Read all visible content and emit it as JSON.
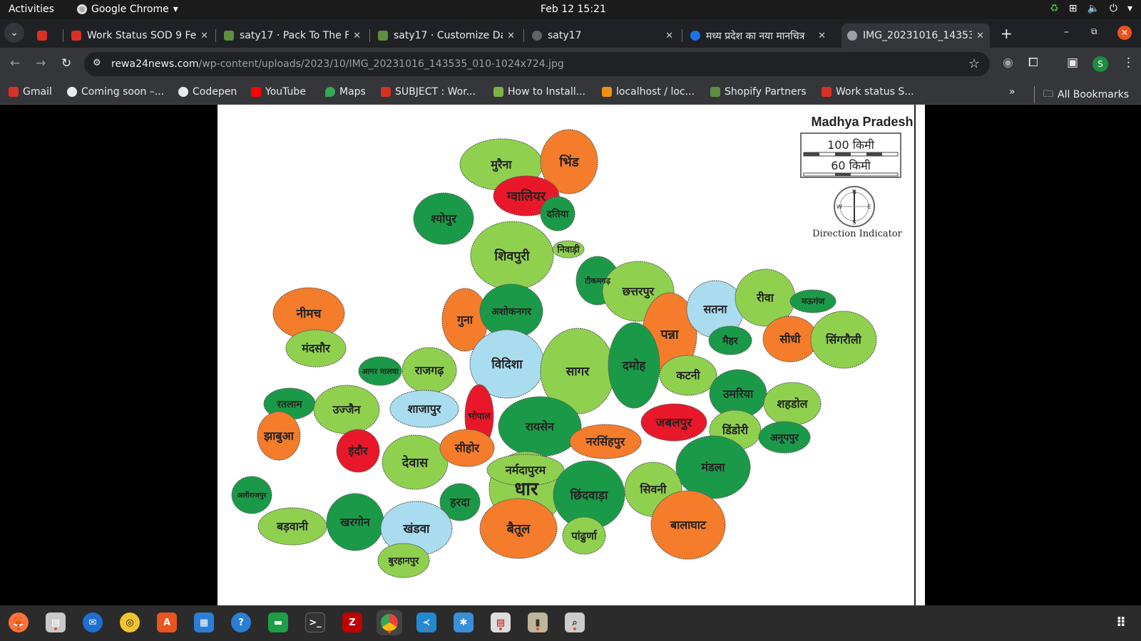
{
  "system_bar": {
    "activities": "Activities",
    "app_name": "Google Chrome",
    "clock": "Feb 12  15:21"
  },
  "tabs": [
    {
      "title": "",
      "favicon_color": "#d93025"
    },
    {
      "title": "Work Status SOD 9 Fe",
      "favicon_color": "#d93025"
    },
    {
      "title": "saty17 · Pack To The F",
      "favicon_color": "#5e8e3e"
    },
    {
      "title": "saty17 · Customize Da",
      "favicon_color": "#5e8e3e"
    },
    {
      "title": "saty17",
      "favicon_color": "#5f6368"
    },
    {
      "title": "मध्य प्रदेश का नया मानचित्र",
      "favicon_color": "#1a73e8"
    },
    {
      "title": "IMG_20231016_14353",
      "favicon_color": "#9aa0a6"
    }
  ],
  "address_bar": {
    "domain": "rewa24news.com",
    "path": "/wp-content/uploads/2023/10/IMG_20231016_143535_010-1024x724.jpg",
    "profile_initial": "S"
  },
  "bookmarks": [
    {
      "label": "Gmail",
      "color": "#d93025"
    },
    {
      "label": "Coming soon –...",
      "color": "#e8eaed"
    },
    {
      "label": "Codepen",
      "color": "#e8eaed"
    },
    {
      "label": "YouTube",
      "color": "#ff0000"
    },
    {
      "label": "Maps",
      "color": "#34a853"
    },
    {
      "label": "SUBJECT : Wor...",
      "color": "#d93025"
    },
    {
      "label": "How to Install...",
      "color": "#7cb342"
    },
    {
      "label": "localhost / loc...",
      "color": "#f29111"
    },
    {
      "label": "Shopify Partners",
      "color": "#5e8e3e"
    },
    {
      "label": "Work status S...",
      "color": "#d93025"
    }
  ],
  "all_bookmarks": "All Bookmarks",
  "map": {
    "title": "Madhya Pradesh",
    "scale_100": "100  किमी",
    "scale_60": "60  किमी",
    "direction_label": "Direction Indicator",
    "compass": {
      "n": "N",
      "s": "S",
      "e": "E",
      "w": "W"
    },
    "colors": {
      "light_green": "#8fd14f",
      "dark_green": "#1a9a48",
      "orange": "#f57c2a",
      "red": "#e8182a",
      "light_blue": "#a9dcee"
    },
    "districts": [
      {
        "name": "मुरैना",
        "color": "light_green"
      },
      {
        "name": "भिंड",
        "color": "orange"
      },
      {
        "name": "ग्वालियर",
        "color": "red"
      },
      {
        "name": "श्योपुर",
        "color": "dark_green"
      },
      {
        "name": "दतिया",
        "color": "dark_green"
      },
      {
        "name": "शिवपुरी",
        "color": "light_green"
      },
      {
        "name": "निवाड़ी",
        "color": "light_green"
      },
      {
        "name": "टीकमगढ़",
        "color": "dark_green"
      },
      {
        "name": "छत्तरपुर",
        "color": "light_green"
      },
      {
        "name": "पन्ना",
        "color": "orange"
      },
      {
        "name": "सतना",
        "color": "light_blue"
      },
      {
        "name": "रीवा",
        "color": "light_green"
      },
      {
        "name": "मऊगंज",
        "color": "dark_green"
      },
      {
        "name": "सीधी",
        "color": "orange"
      },
      {
        "name": "सिंगरौली",
        "color": "light_green"
      },
      {
        "name": "मैहर",
        "color": "dark_green"
      },
      {
        "name": "नीमच",
        "color": "orange"
      },
      {
        "name": "मंदसौर",
        "color": "light_green"
      },
      {
        "name": "गुना",
        "color": "orange"
      },
      {
        "name": "अशोकनगर",
        "color": "dark_green"
      },
      {
        "name": "विदिशा",
        "color": "light_blue"
      },
      {
        "name": "सागर",
        "color": "light_green"
      },
      {
        "name": "दमोह",
        "color": "dark_green"
      },
      {
        "name": "कटनी",
        "color": "light_green"
      },
      {
        "name": "उमरिया",
        "color": "dark_green"
      },
      {
        "name": "शहडोल",
        "color": "light_green"
      },
      {
        "name": "आगर मालवा",
        "color": "dark_green"
      },
      {
        "name": "राजगढ़",
        "color": "light_green"
      },
      {
        "name": "रतलाम",
        "color": "dark_green"
      },
      {
        "name": "उज्जैन",
        "color": "light_green"
      },
      {
        "name": "शाजापुर",
        "color": "light_blue"
      },
      {
        "name": "भोपाल",
        "color": "red"
      },
      {
        "name": "रायसेन",
        "color": "dark_green"
      },
      {
        "name": "जबलपुर",
        "color": "red"
      },
      {
        "name": "डिंडोरी",
        "color": "light_green"
      },
      {
        "name": "अनूपपुर",
        "color": "dark_green"
      },
      {
        "name": "झाबुआ",
        "color": "orange"
      },
      {
        "name": "इंदौर",
        "color": "red"
      },
      {
        "name": "देवास",
        "color": "light_green"
      },
      {
        "name": "सीहोर",
        "color": "orange"
      },
      {
        "name": "नरसिंहपुर",
        "color": "orange"
      },
      {
        "name": "धार",
        "color": "light_green"
      },
      {
        "name": "नर्मदापुरम",
        "color": "light_green"
      },
      {
        "name": "मंडला",
        "color": "dark_green"
      },
      {
        "name": "अलीराजपुर",
        "color": "dark_green"
      },
      {
        "name": "हरदा",
        "color": "dark_green"
      },
      {
        "name": "छिंदवाड़ा",
        "color": "dark_green"
      },
      {
        "name": "सिवनी",
        "color": "light_green"
      },
      {
        "name": "बड़वानी",
        "color": "light_green"
      },
      {
        "name": "खरगोन",
        "color": "dark_green"
      },
      {
        "name": "खंडवा",
        "color": "light_blue"
      },
      {
        "name": "बैतूल",
        "color": "orange"
      },
      {
        "name": "पांढुर्णा",
        "color": "light_green"
      },
      {
        "name": "बालाघाट",
        "color": "orange"
      },
      {
        "name": "बुरहानपुर",
        "color": "light_green"
      }
    ]
  }
}
